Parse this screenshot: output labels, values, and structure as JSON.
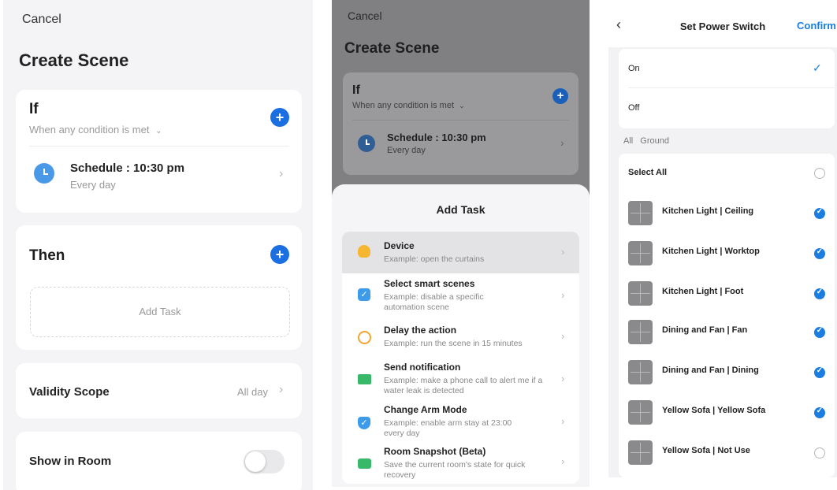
{
  "create_scene": {
    "cancel": "Cancel",
    "title": "Create Scene",
    "if_title": "If",
    "condition": "When any condition is met",
    "schedule_title": "Schedule : 10:30 pm",
    "schedule_sub": "Every day",
    "then_title": "Then",
    "add_task": "Add Task",
    "validity_label": "Validity Scope",
    "validity_value": "All day",
    "show_in_room": "Show in Room",
    "show_in_room_on": false,
    "accent_color": "#1b6fe0"
  },
  "add_task_sheet": {
    "cancel": "Cancel",
    "title": "Create Scene",
    "if_title": "If",
    "condition": "When any condition is met",
    "schedule_title": "Schedule : 10:30 pm",
    "schedule_sub": "Every day",
    "sheet_title": "Add Task",
    "tasks": [
      {
        "title": "Device",
        "desc": "Example: open the curtains",
        "icon": "bulb-icon",
        "color": "#f5b731"
      },
      {
        "title": "Select smart scenes",
        "desc": "Example: disable a specific automation scene",
        "icon": "checkbox-icon",
        "color": "#3d9be9"
      },
      {
        "title": "Delay the action",
        "desc": "Example: run the scene in 15 minutes",
        "icon": "timer-icon",
        "color": "#f3a531"
      },
      {
        "title": "Send notification",
        "desc": "Example: make a phone call to alert me if a water leak is detected",
        "icon": "envelope-icon",
        "color": "#39b86a"
      },
      {
        "title": "Change Arm Mode",
        "desc": "Example: enable arm stay at 23:00 every day",
        "icon": "shield-check-icon",
        "color": "#3d9be9"
      },
      {
        "title": "Room Snapshot (Beta)",
        "desc": "Save the current room's state for quick recovery",
        "icon": "camera-icon",
        "color": "#39b86a"
      }
    ]
  },
  "power_switch": {
    "title": "Set Power Switch",
    "confirm": "Confirm",
    "options": [
      "On",
      "Off"
    ],
    "selected": "On",
    "filters": [
      "All",
      "Ground"
    ],
    "select_all": "Select All",
    "devices": [
      {
        "name": "Kitchen Light | Ceiling",
        "checked": true
      },
      {
        "name": "Kitchen Light | Worktop",
        "checked": true
      },
      {
        "name": "Kitchen Light | Foot",
        "checked": true
      },
      {
        "name": "Dining and Fan | Fan",
        "checked": true
      },
      {
        "name": "Dining and Fan | Dining",
        "checked": true
      },
      {
        "name": "Yellow Sofa | Yellow Sofa",
        "checked": true
      },
      {
        "name": "Yellow Sofa | Not Use",
        "checked": false
      }
    ],
    "accent_color": "#1b7de0"
  }
}
